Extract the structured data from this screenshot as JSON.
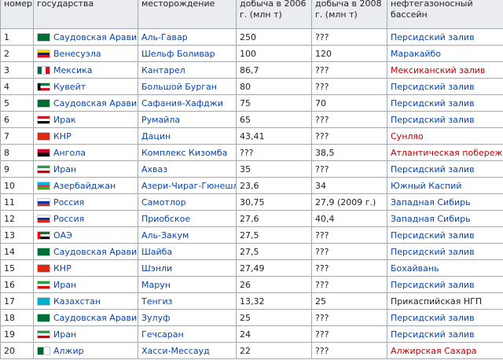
{
  "headers": [
    "номер",
    "государства",
    "месторождение",
    "добыча в 2006 г. (млн т)",
    "добыча в 2008 г. (млн т)",
    "нефтегазоносный бассейн"
  ],
  "rows": [
    {
      "num": "1",
      "country": "Саудовская Аравия",
      "flag": "sa",
      "field": "Аль-Гавар",
      "p2006": "250",
      "p2008": "???",
      "basin": "Персидский залив",
      "basin_color": "blue"
    },
    {
      "num": "2",
      "country": "Венесуэла",
      "flag": "ve",
      "field": "Шельф Боливар",
      "p2006": "100",
      "p2008": "120",
      "basin": "Маракайбо",
      "basin_color": "blue"
    },
    {
      "num": "3",
      "country": "Мексика",
      "flag": "mx",
      "field": "Кантарел",
      "p2006": "86,7",
      "p2008": "???",
      "basin": "Мексиканский залив",
      "basin_color": "red"
    },
    {
      "num": "4",
      "country": "Кувейт",
      "flag": "kw",
      "field": "Большой Бурган",
      "p2006": "80",
      "p2008": "???",
      "basin": "Персидский залив",
      "basin_color": "blue"
    },
    {
      "num": "5",
      "country": "Саудовская Аравия",
      "flag": "sa",
      "field": "Сафания-Хафджи",
      "p2006": "75",
      "p2008": "70",
      "basin": "Персидский залив",
      "basin_color": "blue"
    },
    {
      "num": "6",
      "country": "Ирак",
      "flag": "iq",
      "field": "Румайла",
      "p2006": "65",
      "p2008": "???",
      "basin": "Персидский залив",
      "basin_color": "blue"
    },
    {
      "num": "7",
      "country": "КНР",
      "flag": "cn",
      "field": "Дацин",
      "p2006": "43,41",
      "p2008": "???",
      "basin": "Сунляо",
      "basin_color": "red"
    },
    {
      "num": "8",
      "country": "Ангола",
      "flag": "ao",
      "field": "Комплекс Кизомба",
      "p2006": "???",
      "p2008": "38,5",
      "basin": "Атлантическая побережье",
      "basin_color": "red"
    },
    {
      "num": "9",
      "country": "Иран",
      "flag": "ir",
      "field": "Ахваз",
      "p2006": "35",
      "p2008": "???",
      "basin": "Персидский залив",
      "basin_color": "blue"
    },
    {
      "num": "10",
      "country": "Азербайджан",
      "flag": "az",
      "field": "Азери-Чираг-Гюнешли",
      "p2006": "23,6",
      "p2008": "34",
      "basin": "Южный Каспий",
      "basin_color": "blue"
    },
    {
      "num": "11",
      "country": "Россия",
      "flag": "ru",
      "field": "Самотлор",
      "p2006": "30,75",
      "p2008": "27,9 (2009 г.)",
      "basin": "Западная Сибирь",
      "basin_color": "blue"
    },
    {
      "num": "12",
      "country": "Россия",
      "flag": "ru",
      "field": "Приобское",
      "p2006": "27,6",
      "p2008": "40,4",
      "basin": "Западная Сибирь",
      "basin_color": "blue"
    },
    {
      "num": "13",
      "country": "ОАЭ",
      "flag": "ae",
      "field": "Аль-Закум",
      "p2006": "27,5",
      "p2008": "???",
      "basin": "Персидский залив",
      "basin_color": "blue"
    },
    {
      "num": "14",
      "country": "Саудовская Аравия",
      "flag": "sa",
      "field": "Шайба",
      "p2006": "27,5",
      "p2008": "???",
      "basin": "Персидский залив",
      "basin_color": "blue"
    },
    {
      "num": "15",
      "country": "КНР",
      "flag": "cn",
      "field": "Шэнли",
      "p2006": "27,49",
      "p2008": "???",
      "basin": "Бохайвань",
      "basin_color": "blue"
    },
    {
      "num": "16",
      "country": "Иран",
      "flag": "ir",
      "field": "Марун",
      "p2006": "26",
      "p2008": "???",
      "basin": "Персидский залив",
      "basin_color": "blue"
    },
    {
      "num": "17",
      "country": "Казахстан",
      "flag": "kz",
      "field": "Тенгиз",
      "p2006": "13,32",
      "p2008": "25",
      "basin": "Прикаспийская НГП",
      "basin_color": "plain"
    },
    {
      "num": "18",
      "country": "Саудовская Аравия",
      "flag": "sa",
      "field": "Зулуф",
      "p2006": "25",
      "p2008": "???",
      "basin": "Персидский залив",
      "basin_color": "blue"
    },
    {
      "num": "19",
      "country": "Иран",
      "flag": "ir",
      "field": "Гечсаран",
      "p2006": "24",
      "p2008": "???",
      "basin": "Персидский залив",
      "basin_color": "blue"
    },
    {
      "num": "20",
      "country": "Алжир",
      "flag": "dz",
      "field": "Хасси-Мессауд",
      "p2006": "22",
      "p2008": "???",
      "basin": "Алжирская Сахара",
      "basin_color": "red"
    }
  ]
}
